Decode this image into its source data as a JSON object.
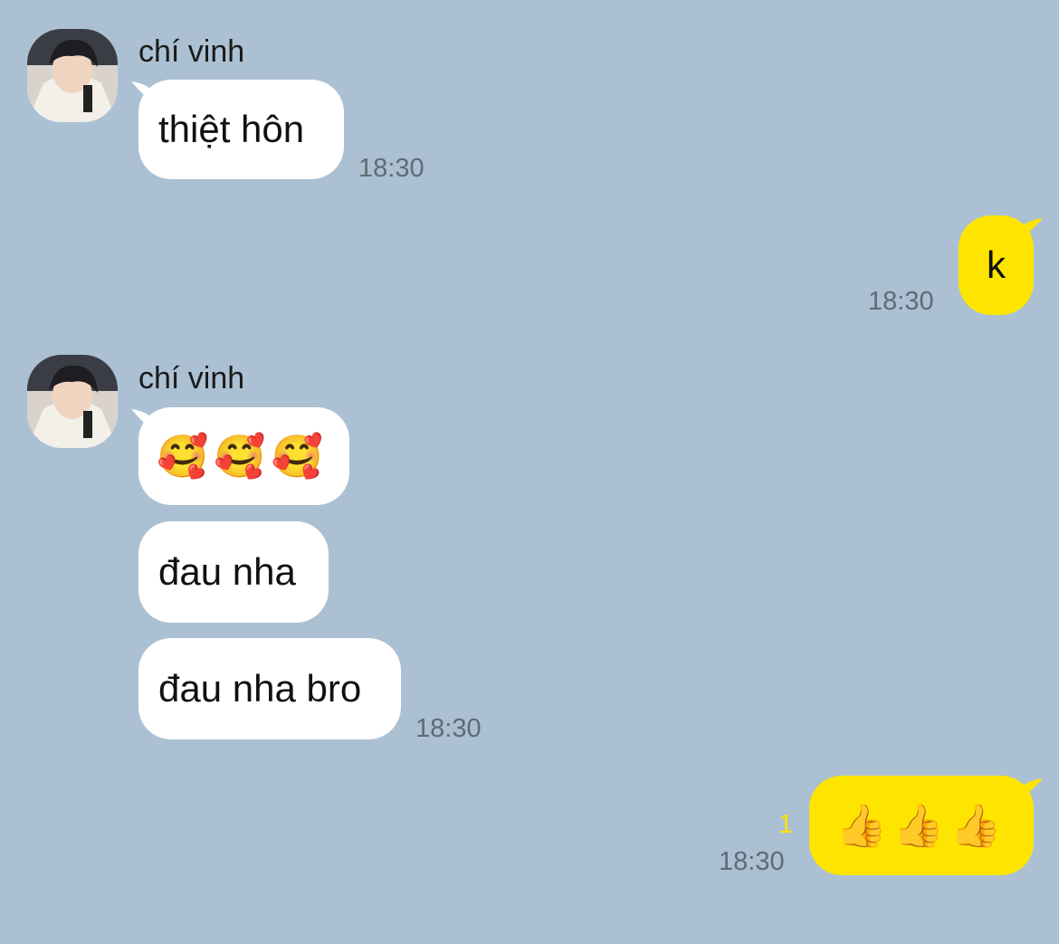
{
  "messages": [
    {
      "type": "incoming",
      "sender": "chí vinh",
      "bubbles": [
        "thiệt hôn"
      ],
      "time": "18:30"
    },
    {
      "type": "outgoing",
      "bubbles": [
        "k"
      ],
      "time": "18:30"
    },
    {
      "type": "incoming",
      "sender": "chí vinh",
      "bubbles": [
        "🥰🥰🥰",
        "đau nha",
        "đau nha bro"
      ],
      "time": "18:30"
    },
    {
      "type": "outgoing",
      "bubbles": [
        "👍👍👍"
      ],
      "time": "18:30",
      "unread_count": "1"
    }
  ],
  "colors": {
    "background": "#abc1d3",
    "incoming_bubble": "#ffffff",
    "outgoing_bubble": "#fee500",
    "timestamp": "#5f6b75",
    "unread_count": "#fee500"
  }
}
